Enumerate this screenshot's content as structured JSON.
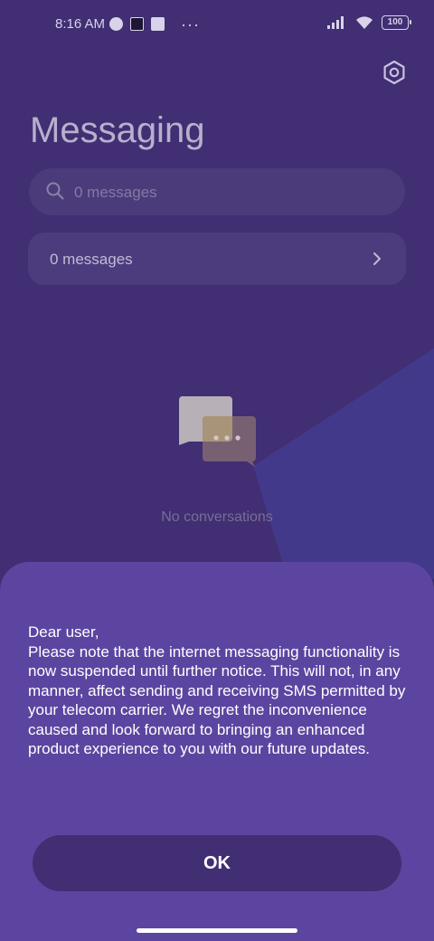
{
  "status_bar": {
    "time": "8:16 AM",
    "battery": "100",
    "overflow": "···",
    "icons": [
      "app-notification-icon",
      "square-notification-icon",
      "upload-notification-icon",
      "signal-icon",
      "wifi-icon",
      "battery-icon"
    ]
  },
  "header": {
    "title": "Messaging",
    "settings_icon": "gear-icon"
  },
  "search": {
    "placeholder": "0 messages"
  },
  "filter": {
    "label": "0 messages"
  },
  "empty_state": {
    "text": "No conversations",
    "icon": "chat-bubbles-icon"
  },
  "dialog": {
    "greeting": "Dear user,",
    "body": "Please note that the internet messaging functionality is now suspended until further notice. This will not, in any manner, affect sending and receiving SMS permitted by your telecom carrier. We regret the inconvenience caused and look forward to bringing an enhanced product experience to you with our future updates.",
    "ok_label": "OK"
  },
  "colors": {
    "background": "#412e73",
    "sheet": "#5c45a0",
    "accent_shape": "#41398a"
  }
}
